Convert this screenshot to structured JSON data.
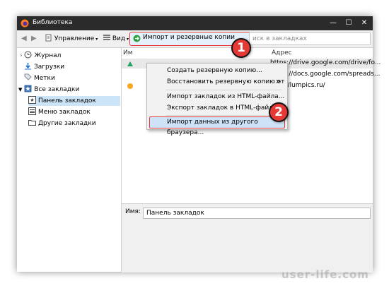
{
  "window": {
    "title": "Библиотека"
  },
  "toolbar": {
    "manage_label": "Управление",
    "views_label": "Вид",
    "import_label": "Импорт и резервные копии",
    "search_placeholder": "иск в закладках"
  },
  "sidebar": {
    "items": [
      {
        "label": "Журнал",
        "icon": "clock-icon"
      },
      {
        "label": "Загрузки",
        "icon": "download-icon"
      },
      {
        "label": "Метки",
        "icon": "tag-icon"
      },
      {
        "label": "Все закладки",
        "icon": "star-icon"
      },
      {
        "label": "Панель закладок",
        "icon": "bookmarks-toolbar-icon",
        "selected": true
      },
      {
        "label": "Меню закладок",
        "icon": "bookmarks-menu-icon"
      },
      {
        "label": "Другие закладки",
        "icon": "folder-icon"
      }
    ]
  },
  "main": {
    "columns": {
      "name": "Им",
      "address": "Адрес"
    },
    "rows": [
      {
        "url": "https://drive.google.com/drive/fo..."
      },
      {
        "url": "https://docs.google.com/spreads..."
      },
      {
        "url": "http://lumpics.ru/"
      }
    ],
    "name_label": "Имя:",
    "name_value": "Панель закладок"
  },
  "menu": {
    "items": [
      {
        "label": "Создать резервную копию..."
      },
      {
        "label": "Восстановить резервную копию от",
        "submenu_arrow": ">"
      },
      {
        "label": "Импорт закладок из HTML-файла..."
      },
      {
        "label": "Экспорт закладок в HTML-файл..."
      },
      {
        "label": "Импорт данных из другого браузера..."
      }
    ]
  },
  "badges": {
    "first": "1",
    "second": "2"
  },
  "watermark": "user-life.com",
  "colors": {
    "titlebar": "#2b2b2b",
    "highlight_border": "#e53935",
    "selection": "#cce4f7"
  }
}
